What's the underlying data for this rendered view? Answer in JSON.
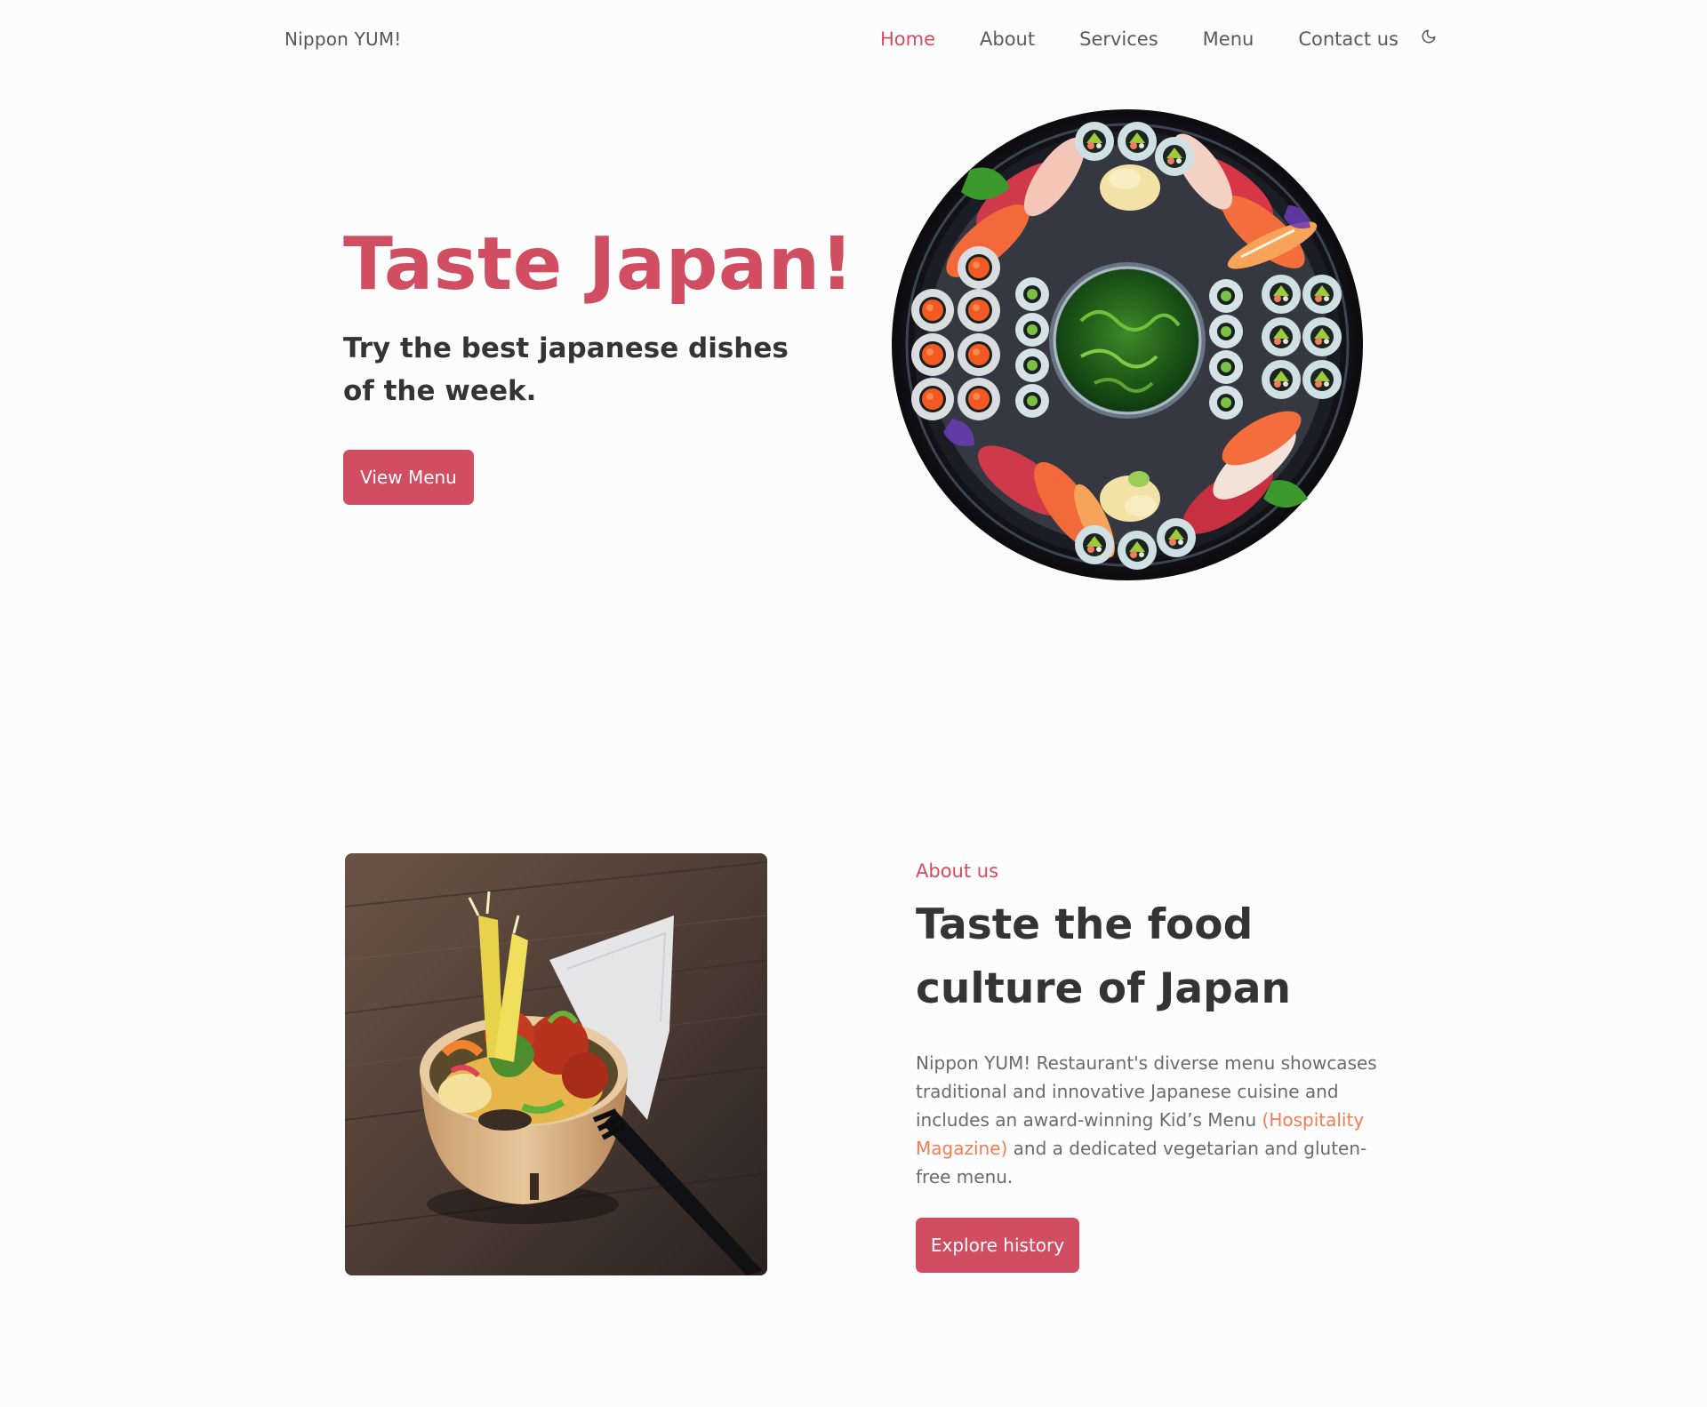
{
  "header": {
    "brand": "Nippon YUM!",
    "nav": [
      {
        "label": "Home",
        "active": true
      },
      {
        "label": "About",
        "active": false
      },
      {
        "label": "Services",
        "active": false
      },
      {
        "label": "Menu",
        "active": false
      },
      {
        "label": "Contact us",
        "active": false
      }
    ],
    "theme_toggle_icon": "moon-icon"
  },
  "hero": {
    "title": "Taste Japan!",
    "subtitle": "Try the best japanese dishes of the week.",
    "button_label": "View Menu",
    "image_icon": "sushi-platter-image"
  },
  "about": {
    "eyebrow": "About us",
    "title": "Taste the food culture of Japan",
    "text_before": "Nippon YUM! Restaurant's diverse menu showcases traditional and innovative Japanese cuisine and includes an award-winning Kid’s Menu ",
    "citation": "(Hospitality Magazine)",
    "text_after": " and a dedicated vegetarian and gluten-free menu.",
    "button_label": "Explore history",
    "image_icon": "bento-bowl-image"
  },
  "colors": {
    "accent": "#d14e62",
    "citation": "#f07d54",
    "text_dark": "#343434",
    "text_muted": "#6b6b6b",
    "background": "#fdfcfc"
  }
}
